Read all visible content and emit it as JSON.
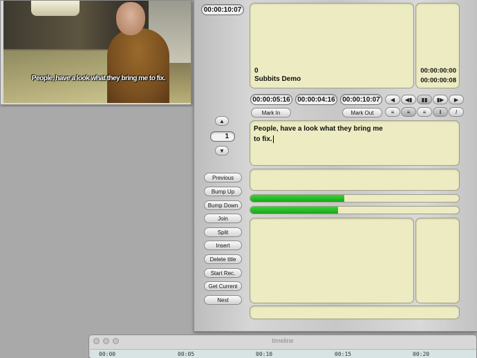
{
  "video": {
    "subtitle_text": "People, have a look what they bring me to fix."
  },
  "panel": {
    "top_timecode": "00:00:10:07",
    "info_box": {
      "index": "0",
      "title": "Subbits Demo",
      "time_a": "00:00:00:00",
      "time_b": "00:00:00:08"
    },
    "timecodes": {
      "in": "00:00:05:16",
      "duration": "00:00:04:16",
      "out": "00:00:10:07"
    },
    "mark_in_label": "Mark In",
    "mark_out_label": "Mark Out",
    "transport_icons": [
      "rewind-icon",
      "step-back-icon",
      "pause-icon",
      "step-forward-icon",
      "play-icon"
    ],
    "style_icons": [
      "align-left-icon",
      "align-center-icon",
      "align-right-icon",
      "bold-icon",
      "italic-icon"
    ],
    "counter_value": "1",
    "edit_text_line1": "People, have a look what they bring me",
    "edit_text_line2": "to fix.",
    "progress1": 0.45,
    "progress2": 0.42,
    "buttons": [
      "Previous",
      "Bump Up",
      "Bump Down",
      "Join",
      "Split",
      "Insert",
      "Delete title",
      "Start Rec.",
      "Get Current",
      "Next"
    ]
  },
  "timeline": {
    "title": "timeline",
    "ticks": [
      "00:00",
      "00:05",
      "00:10",
      "00:15",
      "00:20"
    ]
  },
  "colors": {
    "field": "#ecebc2",
    "progress": "#22b522"
  }
}
